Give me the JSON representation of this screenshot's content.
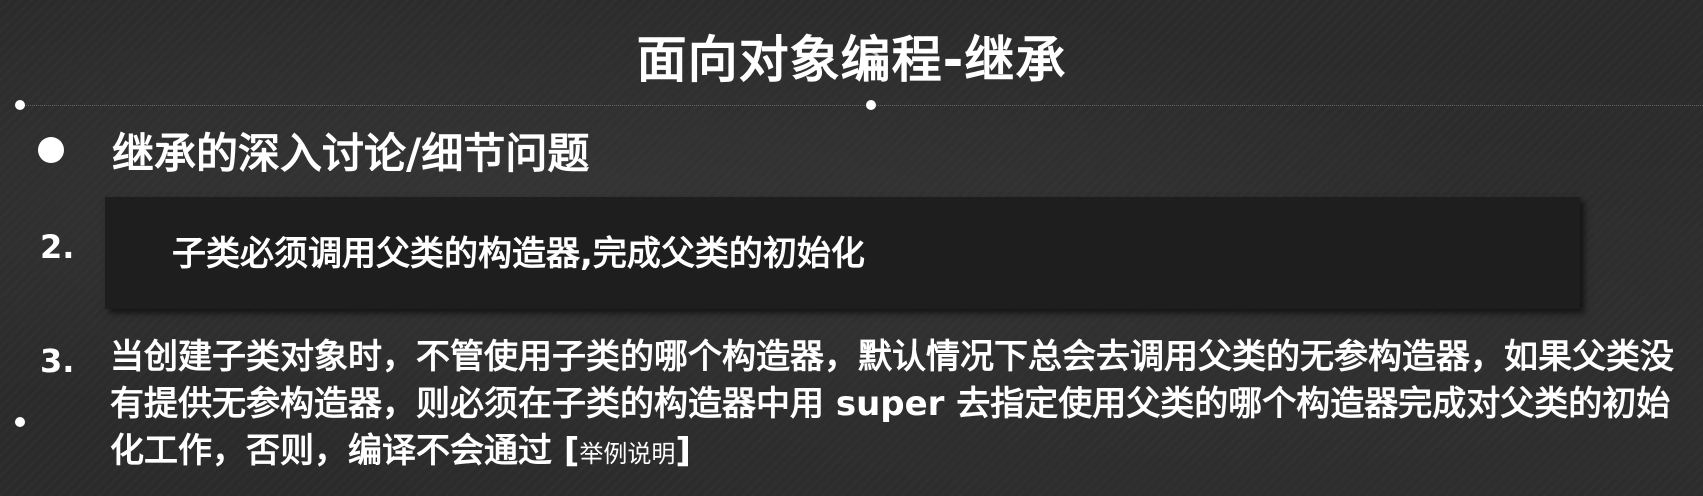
{
  "slide": {
    "title": "面向对象编程-继承",
    "bullet_heading": "继承的深入讨论/细节问题",
    "item2": {
      "number": "2.",
      "text": "子类必须调用父类的构造器,完成父类的初始化"
    },
    "item3": {
      "number": "3.",
      "text": "当创建子类对象时，不管使用子类的哪个构造器，默认情况下总会去调用父类的无参构造器，如果父类没有提供无参构造器，则必须在子类的构造器中用 super 去指定使用父类的哪个构造器完成对父类的初始化工作，否则，编译不会通过",
      "bracket_open": "[",
      "note": "举例说明",
      "bracket_close": "]"
    }
  },
  "colors": {
    "background": "#2b2b2b",
    "text": "#ffffff",
    "highlight_box": "#1e1e1e"
  }
}
